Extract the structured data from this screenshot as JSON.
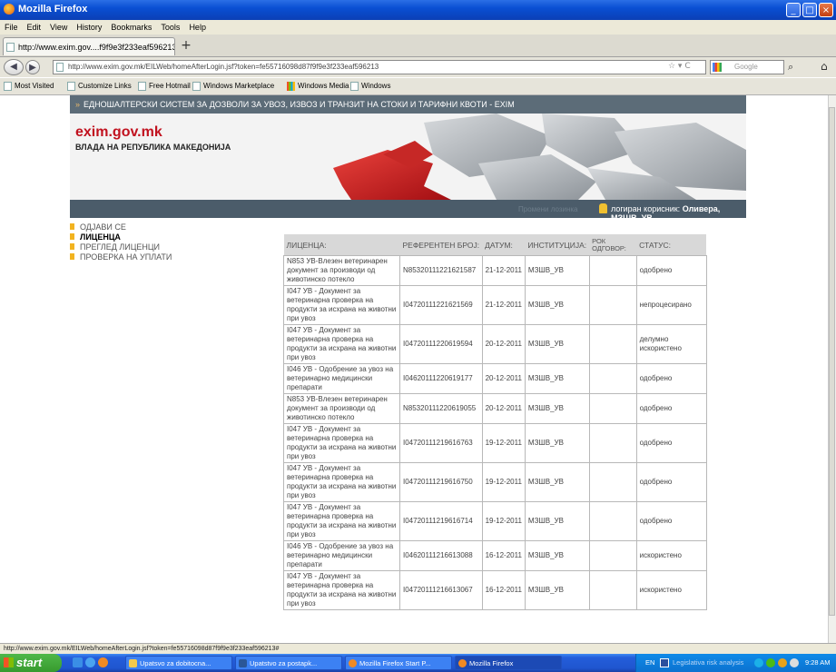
{
  "window": {
    "title": "Mozilla Firefox",
    "controls": [
      "_",
      "□",
      "×"
    ]
  },
  "menu": [
    "File",
    "Edit",
    "View",
    "History",
    "Bookmarks",
    "Tools",
    "Help"
  ],
  "tab": {
    "label": "http://www.exim.gov....f9f9e3f233eaf596213",
    "new_tab": "+"
  },
  "nav": {
    "url": "http://www.exim.gov.mk/EILWeb/homeAfterLogin.jsf?token=fe55716098d87f9f9e3f233eaf596213",
    "search_placeholder": "Google",
    "back": "◀",
    "forward": "▶",
    "reload": "C",
    "home": "⌂",
    "search_go": "⌕",
    "star": "☆ ▾"
  },
  "bookmarks": [
    "Most Visited",
    "Customize Links",
    "Free Hotmail",
    "Windows Marketplace",
    "Windows Media",
    "Windows"
  ],
  "site": {
    "top_strip": "ЕДНОШАЛТЕРСКИ СИСТЕМ ЗА ДОЗВОЛИ ЗА УВОЗ, ИЗВОЗ И ТРАНЗИТ НА СТОКИ И ТАРИФНИ КВОТИ - EXIM",
    "logo": "exim.gov.mk",
    "logo_sub": "ВЛАДА НА РЕПУБЛИКА МАКЕДОНИЈА",
    "change_password": "Промени лозинка",
    "logged_label": "логиран корисник:",
    "logged_user": "Оливера, МЗШВ_УВ"
  },
  "left_menu": [
    {
      "label": "ОДЈАВИ СЕ",
      "active": false
    },
    {
      "label": "ЛИЦЕНЦА",
      "active": true
    },
    {
      "label": "ПРЕГЛЕД ЛИЦЕНЦИ",
      "active": false
    },
    {
      "label": "ПРОВЕРКА НА УПЛАТИ",
      "active": false
    }
  ],
  "table": {
    "headers": [
      "ЛИЦЕНЦА:",
      "РЕФЕРЕНТЕН БРОЈ:",
      "ДАТУМ:",
      "ИНСТИТУЦИЈА:",
      "РОК ОДГОВОР:",
      "СТАТУС:"
    ],
    "rows": [
      {
        "licence": "N853 УВ-Влезен ветеринарен документ за производи од животинско потекло",
        "ref": "N85320111221621587",
        "date": "21-12-2011",
        "inst": "МЗШВ_УВ",
        "rok": "",
        "status": "одобрено"
      },
      {
        "licence": "I047 УВ - Документ за ветеринарна проверка на продукти за исхрана на животни при увоз",
        "ref": "I04720111221621569",
        "date": "21-12-2011",
        "inst": "МЗШВ_УВ",
        "rok": "",
        "status": "непроцесирано"
      },
      {
        "licence": "I047 УВ - Документ за ветеринарна проверка на продукти за исхрана на животни при увоз",
        "ref": "I04720111220619594",
        "date": "20-12-2011",
        "inst": "МЗШВ_УВ",
        "rok": "",
        "status": "делумно искористено"
      },
      {
        "licence": "I046 УВ - Одобрение за увоз на ветеринарно медицински препарати",
        "ref": "I04620111220619177",
        "date": "20-12-2011",
        "inst": "МЗШВ_УВ",
        "rok": "",
        "status": "одобрено"
      },
      {
        "licence": "N853 УВ-Влезен ветеринарен документ за производи од животинско потекло",
        "ref": "N85320111220619055",
        "date": "20-12-2011",
        "inst": "МЗШВ_УВ",
        "rok": "",
        "status": "одобрено"
      },
      {
        "licence": "I047 УВ - Документ за ветеринарна проверка на продукти за исхрана на животни при увоз",
        "ref": "I04720111219616763",
        "date": "19-12-2011",
        "inst": "МЗШВ_УВ",
        "rok": "",
        "status": "одобрено"
      },
      {
        "licence": "I047 УВ - Документ за ветеринарна проверка на продукти за исхрана на животни при увоз",
        "ref": "I04720111219616750",
        "date": "19-12-2011",
        "inst": "МЗШВ_УВ",
        "rok": "",
        "status": "одобрено"
      },
      {
        "licence": "I047 УВ - Документ за ветеринарна проверка на продукти за исхрана на животни при увоз",
        "ref": "I04720111219616714",
        "date": "19-12-2011",
        "inst": "МЗШВ_УВ",
        "rok": "",
        "status": "одобрено"
      },
      {
        "licence": "I046 УВ - Одобрение за увоз на ветеринарно медицински препарати",
        "ref": "I04620111216613088",
        "date": "16-12-2011",
        "inst": "МЗШВ_УВ",
        "rok": "",
        "status": "искористено"
      },
      {
        "licence": "I047 УВ - Документ за ветеринарна проверка на продукти за исхрана на животни при увоз",
        "ref": "I04720111216613067",
        "date": "16-12-2011",
        "inst": "МЗШВ_УВ",
        "rok": "",
        "status": "искористено"
      }
    ]
  },
  "status_bar": "http://www.exim.gov.mk/EILWeb/homeAfterLogin.jsf?token=fe55716098d87f9f9e3f233eaf596213#",
  "taskbar": {
    "start": "start",
    "tasks": [
      "Upatsvo za dobitocna...",
      "Upatstvo za postapk...",
      "Mozilla Firefox Start P...",
      "Mozilla Firefox"
    ],
    "lang": "EN",
    "tray_text": "Legislativa risk analysis",
    "clock": "9:28 AM"
  }
}
